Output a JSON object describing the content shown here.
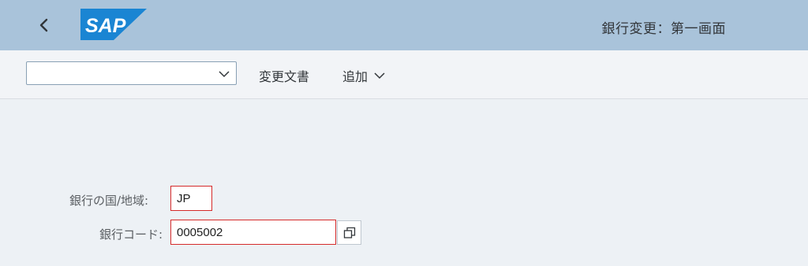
{
  "shell": {
    "title": "銀行変更：第一画面",
    "logo_text": "SAP",
    "brand_color": "#1a85d3",
    "header_color": "#a9c3da"
  },
  "icons": {
    "back": "back-arrow-icon",
    "dropdown": "chevron-down-icon",
    "value_help": "value-help-icon"
  },
  "toolbar": {
    "command_select_value": "",
    "change_docs_label": "変更文書",
    "more_label": "追加"
  },
  "form": {
    "country_label": "銀行の国/地域:",
    "country_value": "JP",
    "bank_code_label": "銀行コード:",
    "bank_code_value": "0005002"
  }
}
